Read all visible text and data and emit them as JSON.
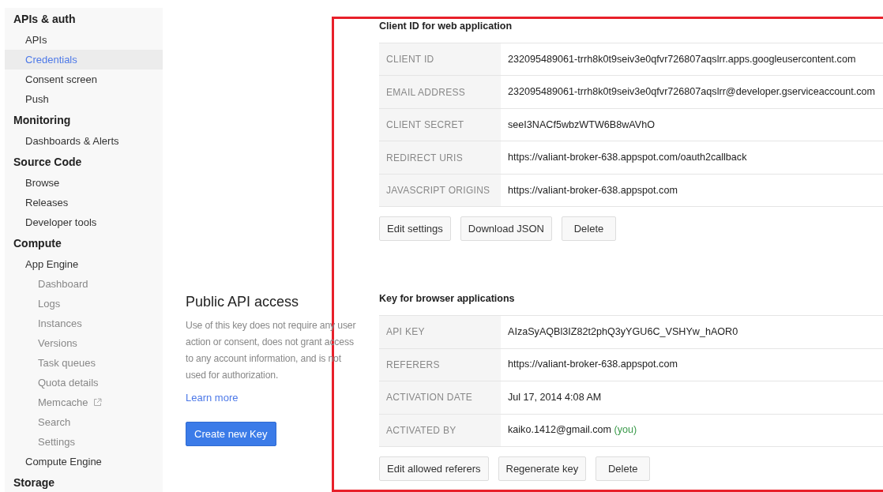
{
  "sidebar": {
    "sections": [
      {
        "title": "APIs & auth",
        "items": [
          {
            "label": "APIs",
            "selected": false
          },
          {
            "label": "Credentials",
            "selected": true
          },
          {
            "label": "Consent screen",
            "selected": false
          },
          {
            "label": "Push",
            "selected": false
          }
        ]
      },
      {
        "title": "Monitoring",
        "items": [
          {
            "label": "Dashboards & Alerts",
            "selected": false
          }
        ]
      },
      {
        "title": "Source Code",
        "items": [
          {
            "label": "Browse",
            "selected": false
          },
          {
            "label": "Releases",
            "selected": false
          },
          {
            "label": "Developer tools",
            "selected": false
          }
        ]
      },
      {
        "title": "Compute",
        "items": [
          {
            "label": "App Engine",
            "selected": false,
            "children": [
              {
                "label": "Dashboard",
                "selected": false
              },
              {
                "label": "Logs",
                "selected": false
              },
              {
                "label": "Instances",
                "selected": false
              },
              {
                "label": "Versions",
                "selected": false
              },
              {
                "label": "Task queues",
                "selected": false
              },
              {
                "label": "Quota details",
                "selected": false
              },
              {
                "label": "Memcache",
                "selected": false,
                "external": true
              },
              {
                "label": "Search",
                "selected": false
              },
              {
                "label": "Settings",
                "selected": false
              }
            ]
          },
          {
            "label": "Compute Engine",
            "selected": false
          }
        ]
      },
      {
        "title": "Storage"
      }
    ]
  },
  "public_api": {
    "title": "Public API access",
    "description": "Use of this key does not require any user action or consent, does not grant access to any account information, and is not used for authorization.",
    "link": "Learn more",
    "button": "Create new Key"
  },
  "client_id": {
    "title": "Client ID for web application",
    "rows": [
      {
        "label": "CLIENT ID",
        "value": "232095489061-trrh8k0t9seiv3e0qfvr726807aqslrr.apps.googleusercontent.com"
      },
      {
        "label": "EMAIL ADDRESS",
        "value": "232095489061-trrh8k0t9seiv3e0qfvr726807aqslrr@developer.gserviceaccount.com"
      },
      {
        "label": "CLIENT SECRET",
        "value": "seeI3NACf5wbzWTW6B8wAVhO"
      },
      {
        "label": "REDIRECT URIS",
        "value": "https://valiant-broker-638.appspot.com/oauth2callback"
      },
      {
        "label": "JAVASCRIPT ORIGINS",
        "value": "https://valiant-broker-638.appspot.com"
      }
    ],
    "buttons": [
      "Edit settings",
      "Download JSON",
      "Delete"
    ]
  },
  "browser_key": {
    "title": "Key for browser applications",
    "rows": [
      {
        "label": "API KEY",
        "value": "AIzaSyAQBl3IZ82t2phQ3yYGU6C_VSHYw_hAOR0"
      },
      {
        "label": "REFERERS",
        "value": "https://valiant-broker-638.appspot.com"
      },
      {
        "label": "ACTIVATION DATE",
        "value": "Jul 17, 2014 4:08 AM"
      },
      {
        "label": "ACTIVATED BY",
        "value": "kaiko.1412@gmail.com",
        "note": "(you)"
      }
    ],
    "buttons": [
      "Edit allowed referers",
      "Regenerate key",
      "Delete"
    ]
  }
}
